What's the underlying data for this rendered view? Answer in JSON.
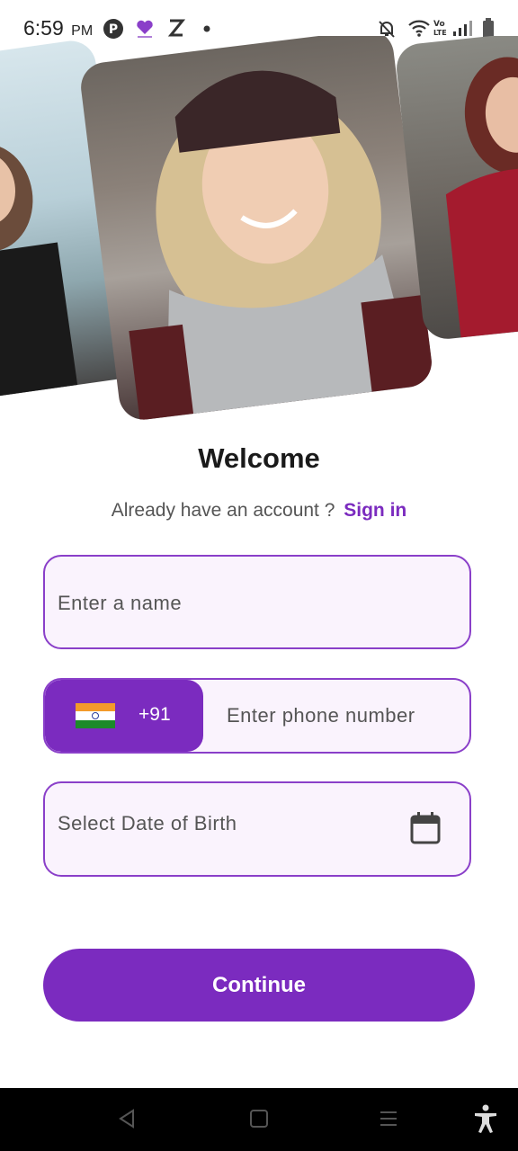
{
  "status_bar": {
    "time": "6:59",
    "ampm": "PM",
    "left_icons": [
      "pinterest-like-icon",
      "app-heart-icon",
      "z-icon",
      "dot-icon"
    ],
    "right_icons": [
      "notification-off-icon",
      "wifi-icon",
      "volte-icon",
      "signal-icon",
      "battery-icon"
    ]
  },
  "welcome": {
    "title": "Welcome",
    "account_prompt": "Already have an account ?",
    "signin_label": "Sign in"
  },
  "form": {
    "name_placeholder": "Enter a name",
    "country_code": "+91",
    "phone_placeholder": "Enter phone number",
    "dob_placeholder": "Select Date of Birth"
  },
  "continue_label": "Continue",
  "colors": {
    "accent": "#7b2bbf",
    "field_bg": "#faf3fd",
    "field_border": "#8a3fc9"
  }
}
